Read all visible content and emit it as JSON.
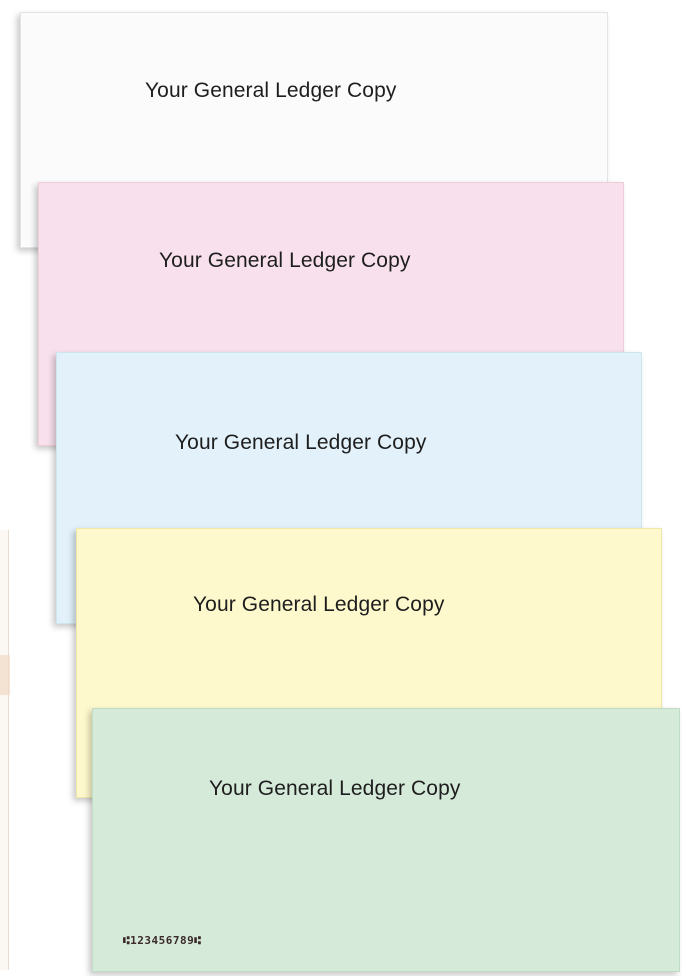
{
  "sheets": [
    {
      "color_name": "white",
      "color": "#fbfbfc",
      "caption": "Your General Ledger Copy"
    },
    {
      "color_name": "pink",
      "color": "#f8e1ec",
      "caption": "Your General Ledger Copy"
    },
    {
      "color_name": "blue",
      "color": "#e2f1fa",
      "caption": "Your General Ledger Copy"
    },
    {
      "color_name": "yellow",
      "color": "#fef9cd",
      "caption": "Your General Ledger Copy"
    },
    {
      "color_name": "green",
      "color": "#d6eada",
      "caption": "Your General Ledger Copy"
    }
  ],
  "micr_line": "⑆123456789⑆"
}
